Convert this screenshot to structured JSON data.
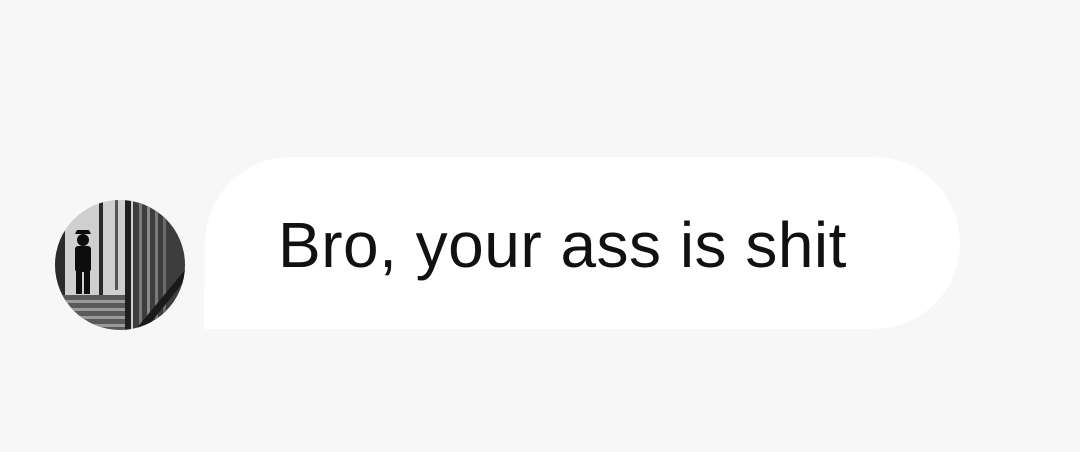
{
  "message": {
    "text": "Bro, your ass is shit",
    "sender_avatar_icon": "profile-photo-icon"
  },
  "colors": {
    "background": "#f7f7f7",
    "bubble": "#ffffff",
    "text": "#111111"
  }
}
